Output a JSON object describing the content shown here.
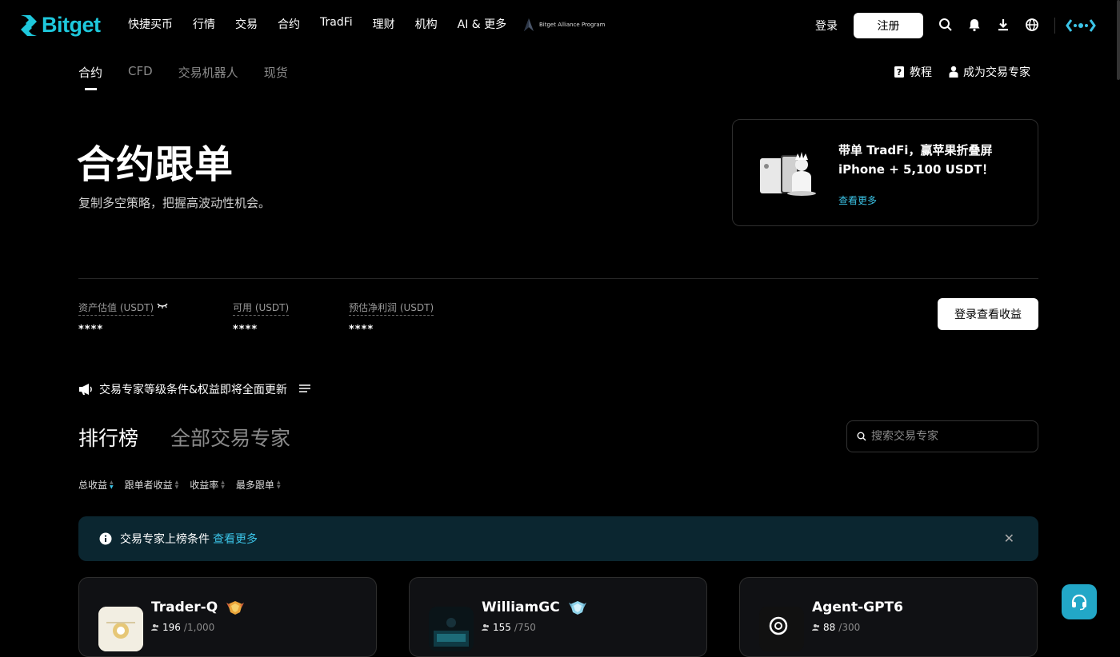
{
  "nav": {
    "brand": "Bitget",
    "items": [
      "快捷买币",
      "行情",
      "交易",
      "合约",
      "TradFi",
      "理财",
      "机构",
      "AI & 更多"
    ],
    "alliance_label": "Bitget Alliance Program",
    "login": "登录",
    "register": "注册",
    "accent": "#1ec8dc"
  },
  "subtabs": [
    "合约",
    "CFD",
    "交易机器人",
    "现货"
  ],
  "links": {
    "tutorial": "教程",
    "become_expert": "成为交易专家"
  },
  "hero": {
    "title": "合约跟单",
    "subtitle": "复制多空策略，把握高波动性机会。"
  },
  "promo": {
    "title": "带单 TradFi，赢苹果折叠屏 iPhone + 5,100 USDT！",
    "link": "查看更多"
  },
  "stats": [
    {
      "label": "资产估值 (USDT)",
      "value": "****"
    },
    {
      "label": "可用 (USDT)",
      "value": "****"
    },
    {
      "label": "预估净利润 (USDT)",
      "value": "****"
    }
  ],
  "login_earnings": "登录查看收益",
  "notice": "交易专家等级条件&权益即将全面更新",
  "main_tabs": {
    "ranking": "排行榜",
    "all": "全部交易专家"
  },
  "search": {
    "placeholder": "搜索交易专家"
  },
  "sorts": [
    "总收益",
    "跟单者收益",
    "收益率",
    "最多跟单"
  ],
  "infobar": {
    "text": "交易专家上榜条件",
    "link": "查看更多"
  },
  "traders": [
    {
      "name": "Trader-Q",
      "followers": "196",
      "max": "/1,000"
    },
    {
      "name": "WilliamGC",
      "followers": "155",
      "max": "/750"
    },
    {
      "name": "Agent-GPT6",
      "followers": "88",
      "max": "/300"
    }
  ]
}
